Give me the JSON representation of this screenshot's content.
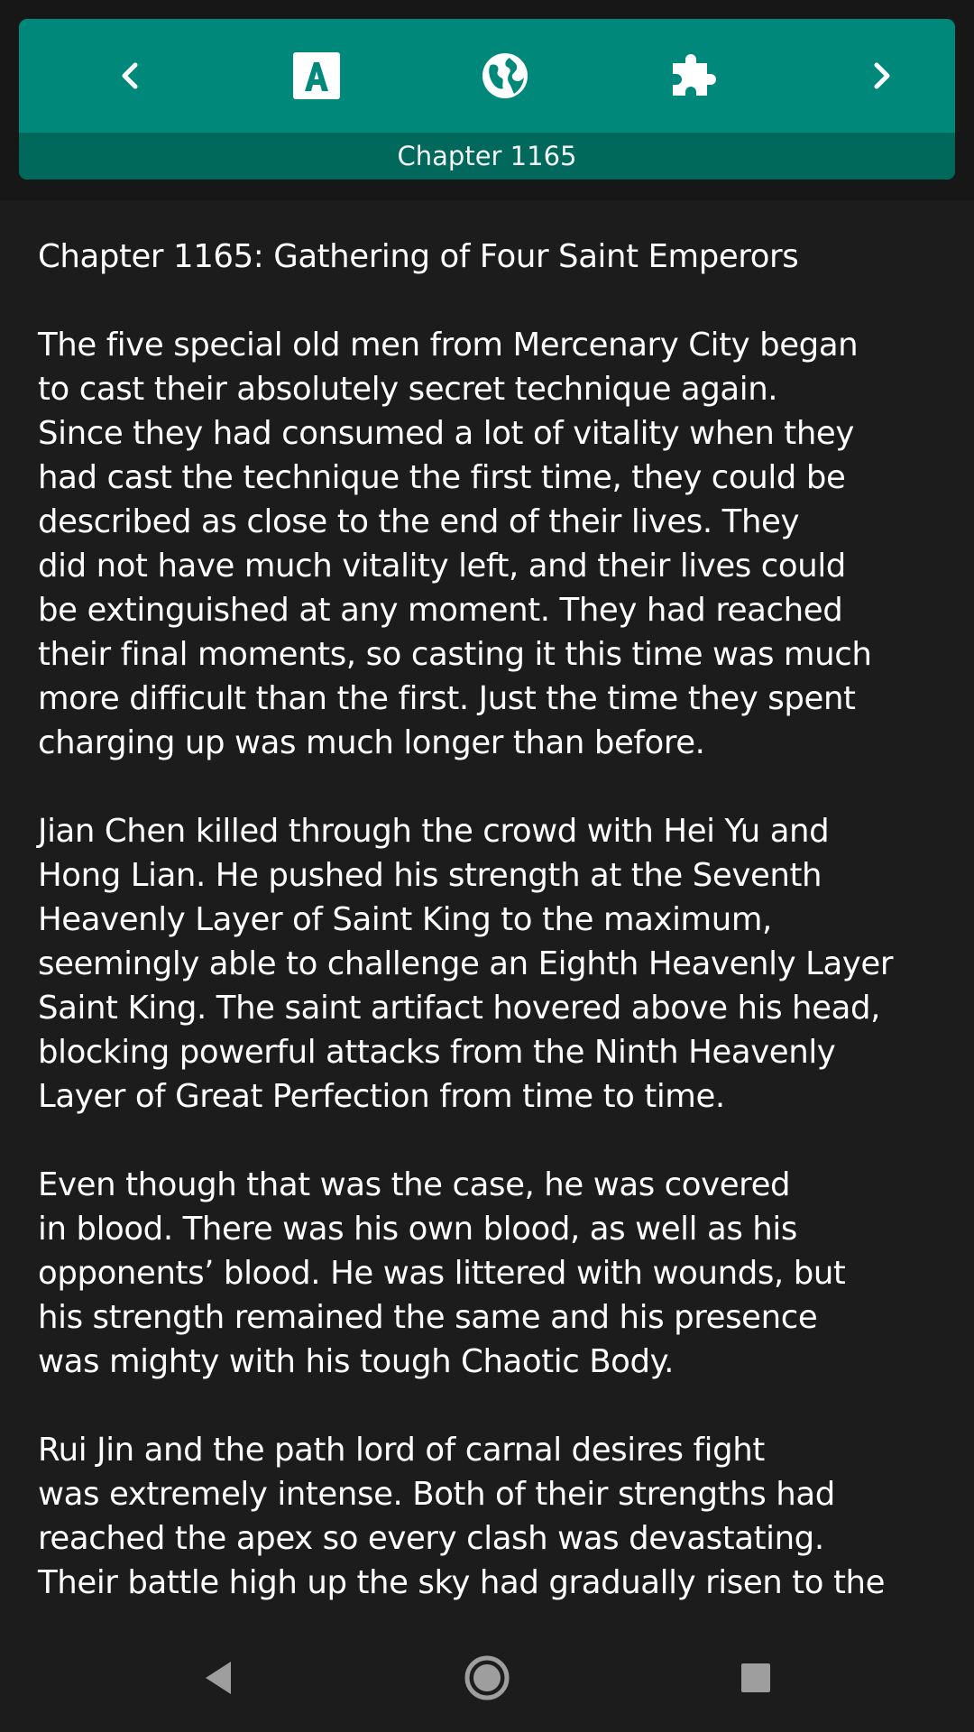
{
  "toolbar": {
    "accent_color": "#00897b",
    "bar_color": "#00695c",
    "buttons": [
      {
        "icon": "chevron-left-icon"
      },
      {
        "icon": "font-a-icon"
      },
      {
        "icon": "globe-icon"
      },
      {
        "icon": "puzzle-icon"
      },
      {
        "icon": "chevron-right-icon"
      }
    ],
    "chapter_label": "Chapter 1165"
  },
  "content": {
    "title": "Chapter 1165: Gathering of Four Saint Emperors",
    "paragraphs": [
      "The five special old men from Mercenary City began\nto cast their absolutely secret technique again.\nSince they had consumed a lot of vitality when they\nhad cast the technique the first time, they could be\ndescribed as close to the end of their lives. They\ndid not have much vitality left, and their lives could\nbe extinguished at any moment. They had reached\ntheir final moments, so casting it this time was much\nmore difficult than the first. Just the time they spent\ncharging up was much longer than before.",
      "Jian Chen killed through the crowd with Hei Yu and\nHong Lian. He pushed his strength at the Seventh\nHeavenly Layer of Saint King to the maximum,\nseemingly able to challenge an Eighth Heavenly Layer\nSaint King. The saint artifact hovered above his head,\nblocking powerful attacks from the Ninth Heavenly\nLayer of Great Perfection from time to time.",
      "Even though that was the case, he was covered\nin blood. There was his own blood, as well as his\nopponents’ blood. He was littered with wounds, but\nhis strength remained the same and his presence\nwas mighty with his tough Chaotic Body.",
      "Rui Jin and the path lord of carnal desires fight\nwas extremely intense. Both of their strengths had\nreached the apex so every clash was devastating.\nTheir battle high up the sky had gradually risen to the"
    ]
  },
  "nav": {
    "buttons": [
      {
        "icon": "back-triangle-icon"
      },
      {
        "icon": "home-circle-icon"
      },
      {
        "icon": "recents-square-icon"
      }
    ]
  }
}
